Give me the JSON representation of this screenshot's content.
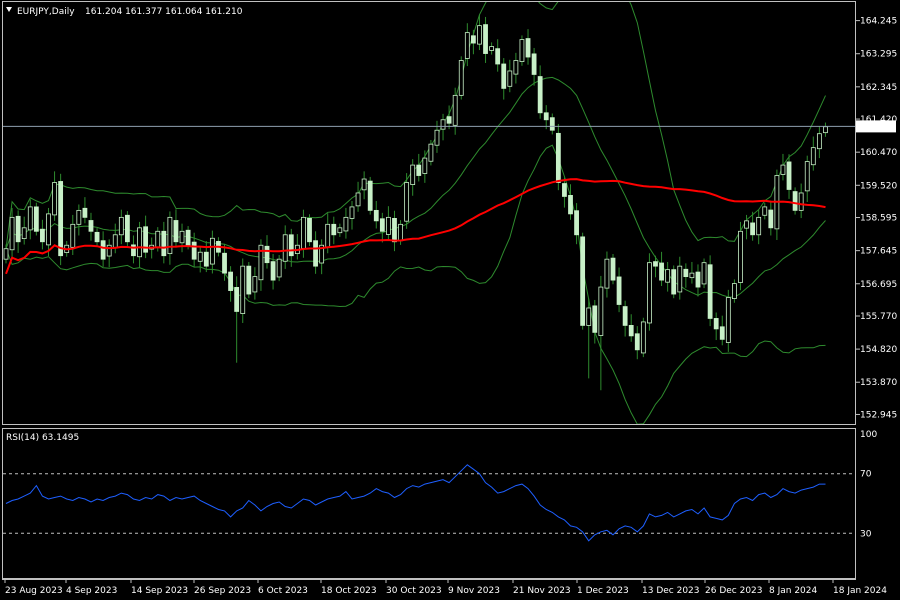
{
  "header": {
    "symbol_label": "EURJPY,Daily",
    "ohlc_label": "161.204 161.377 161.064 161.210"
  },
  "rsi_panel": {
    "label": "RSI(14) 63.1495"
  },
  "colors": {
    "background": "#000000",
    "frame": "#c0c0c0",
    "candle_body": "#c8f0c8",
    "candle_wick": "#2e8b2e",
    "bollinger": "#2e8b2e",
    "moving_average": "#ff0000",
    "rsi_line": "#1e5fff",
    "rsi_levels": "#c0c0c0",
    "current_price_line": "#8fa0b0",
    "text": "#ffffff"
  },
  "chart_data": [
    {
      "type": "candlestick",
      "symbol": "EURJPY",
      "timeframe": "Daily",
      "y_ticks": [
        "164.245",
        "163.295",
        "162.345",
        "161.420",
        "160.470",
        "159.520",
        "158.595",
        "157.645",
        "156.695",
        "155.770",
        "154.820",
        "153.870",
        "152.945"
      ],
      "ylim": [
        152.7,
        164.75
      ],
      "current_price": "161.210",
      "x_tick_labels": [
        "23 Aug 2023",
        "4 Sep 2023",
        "14 Sep 2023",
        "26 Sep 2023",
        "6 Oct 2023",
        "18 Oct 2023",
        "30 Oct 2023",
        "9 Nov 2023",
        "21 Nov 2023",
        "1 Dec 2023",
        "13 Dec 2023",
        "26 Dec 2023",
        "8 Jan 2024",
        "18 Jan 2024"
      ],
      "close": [
        157.7,
        158.6,
        157.9,
        158.3,
        158.9,
        158.2,
        157.9,
        158.7,
        159.6,
        157.5,
        157.8,
        158.4,
        158.8,
        158.6,
        158.2,
        157.9,
        157.4,
        157.8,
        158.1,
        158.6,
        157.9,
        157.5,
        158.3,
        157.6,
        157.8,
        158.2,
        157.5,
        158.6,
        157.9,
        158.2,
        157.8,
        157.4,
        157.6,
        157.2,
        158.0,
        157.6,
        157.0,
        156.5,
        155.9,
        157.2,
        156.4,
        156.9,
        157.8,
        157.3,
        156.8,
        157.4,
        158.1,
        157.5,
        157.8,
        158.6,
        157.9,
        157.2,
        157.8,
        158.4,
        158.1,
        158.3,
        158.6,
        158.9,
        159.3,
        159.7,
        158.8,
        158.5,
        158.2,
        158.6,
        157.9,
        158.4,
        159.6,
        160.1,
        159.8,
        160.3,
        160.7,
        161.1,
        161.4,
        161.3,
        162.1,
        163.1,
        163.9,
        163.6,
        164.1,
        163.3,
        163.5,
        163.0,
        162.3,
        162.8,
        163.1,
        163.7,
        163.2,
        162.7,
        161.6,
        161.4,
        161.1,
        159.6,
        159.2,
        158.7,
        158.1,
        155.5,
        156.0,
        155.3,
        156.6,
        157.4,
        156.8,
        156.1,
        155.5,
        155.2,
        154.8,
        155.6,
        157.3,
        157.2,
        156.8,
        157.1,
        156.4,
        157.2,
        156.9,
        157.0,
        156.6,
        157.3,
        155.7,
        155.4,
        155.1,
        156.3,
        156.7,
        158.2,
        158.5,
        158.1,
        158.6,
        158.9,
        158.3,
        159.8,
        160.1,
        159.4,
        158.8,
        159.3,
        160.2,
        160.6,
        161.0,
        161.2
      ]
    },
    {
      "type": "line",
      "indicator": "RSI(14)",
      "y_ticks": [
        "100",
        "70",
        "30"
      ],
      "ylim": [
        0,
        100
      ],
      "levels": [
        70,
        30
      ],
      "values": [
        50,
        52,
        53,
        55,
        57,
        62,
        55,
        53,
        54,
        55,
        53,
        52,
        54,
        53,
        51,
        53,
        52,
        54,
        55,
        57,
        56,
        53,
        52,
        54,
        53,
        56,
        55,
        52,
        54,
        53,
        54,
        55,
        52,
        50,
        48,
        46,
        45,
        41,
        45,
        47,
        52,
        49,
        45,
        48,
        50,
        51,
        48,
        47,
        50,
        53,
        52,
        49,
        51,
        53,
        54,
        55,
        58,
        53,
        54,
        55,
        57,
        60,
        58,
        57,
        54,
        56,
        60,
        62,
        61,
        63,
        64,
        65,
        66,
        64,
        68,
        72,
        76,
        73,
        70,
        64,
        61,
        57,
        58,
        60,
        62,
        63,
        60,
        55,
        49,
        46,
        44,
        41,
        39,
        35,
        34,
        31,
        25,
        29,
        31,
        32,
        29,
        33,
        35,
        34,
        31,
        35,
        43,
        41,
        42,
        44,
        41,
        43,
        45,
        46,
        43,
        47,
        41,
        40,
        39,
        42,
        50,
        53,
        54,
        52,
        56,
        57,
        54,
        56,
        60,
        58,
        57,
        59,
        60,
        61,
        63,
        63
      ]
    }
  ]
}
